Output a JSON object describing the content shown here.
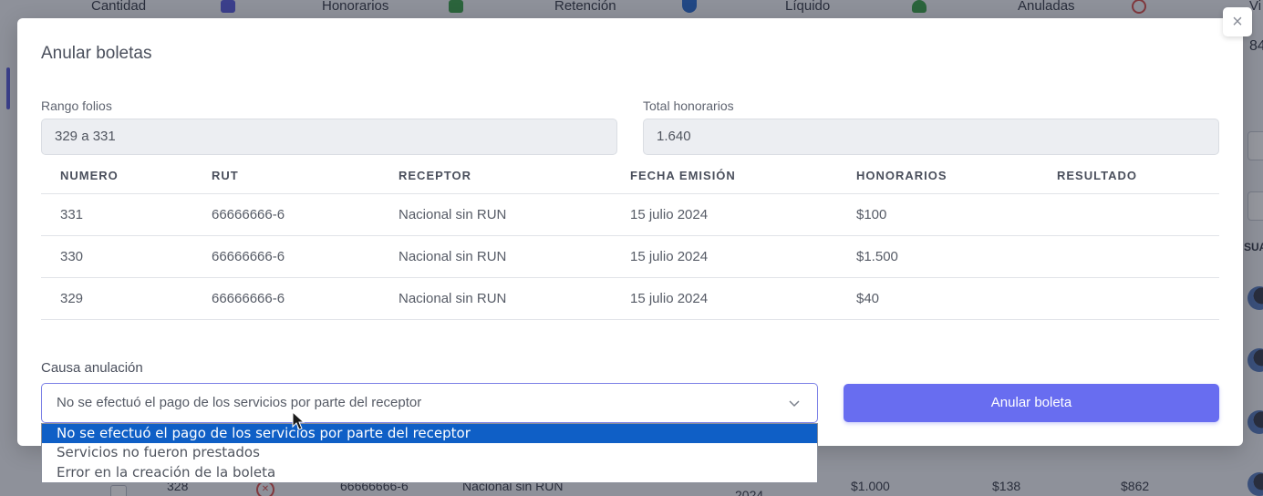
{
  "background": {
    "stats": [
      {
        "label": "Cantidad",
        "icon": "book-icon",
        "color": "#5b5fdc"
      },
      {
        "label": "Honorarios",
        "icon": "money-icon",
        "color": "#3fa34d"
      },
      {
        "label": "Retención",
        "icon": "shield-icon",
        "color": "#2f6fd0"
      },
      {
        "label": "Líquido",
        "icon": "plant-icon",
        "color": "#3fa34d"
      },
      {
        "label": "Anuladas",
        "icon": "ban-icon",
        "color": "#d9534f"
      },
      {
        "label": "Vi"
      }
    ],
    "right_texts": {
      "count": "84",
      "header": "SUA"
    },
    "row": {
      "number": "328",
      "rut": "66666666-6",
      "receptor": "Nacional sin RUN",
      "year": "2024",
      "honorarios": "$1.000",
      "retencion": "$138",
      "liquido": "$862"
    }
  },
  "modal": {
    "title": "Anular boletas",
    "close_symbol": "×",
    "rango_label": "Rango folios",
    "rango_value": "329 a 331",
    "total_label": "Total honorarios",
    "total_value": "1.640",
    "table": {
      "headers": [
        "NUMERO",
        "RUT",
        "RECEPTOR",
        "FECHA EMISIÓN",
        "HONORARIOS",
        "RESULTADO"
      ],
      "rows": [
        {
          "numero": "331",
          "rut": "66666666-6",
          "receptor": "Nacional sin RUN",
          "fecha": "15 julio 2024",
          "honorarios": "$100",
          "resultado": ""
        },
        {
          "numero": "330",
          "rut": "66666666-6",
          "receptor": "Nacional sin RUN",
          "fecha": "15 julio 2024",
          "honorarios": "$1.500",
          "resultado": ""
        },
        {
          "numero": "329",
          "rut": "66666666-6",
          "receptor": "Nacional sin RUN",
          "fecha": "15 julio 2024",
          "honorarios": "$40",
          "resultado": ""
        }
      ]
    },
    "causa_label": "Causa anulación",
    "causa_selected": "No se efectuó el pago de los servicios por parte del receptor",
    "causa_options": [
      "No se efectuó el pago de los servicios por parte del receptor",
      "Servicios no fueron prestados",
      "Error en la creación de la boleta"
    ],
    "submit_label": "Anular boleta",
    "accent_color": "#686df0"
  }
}
